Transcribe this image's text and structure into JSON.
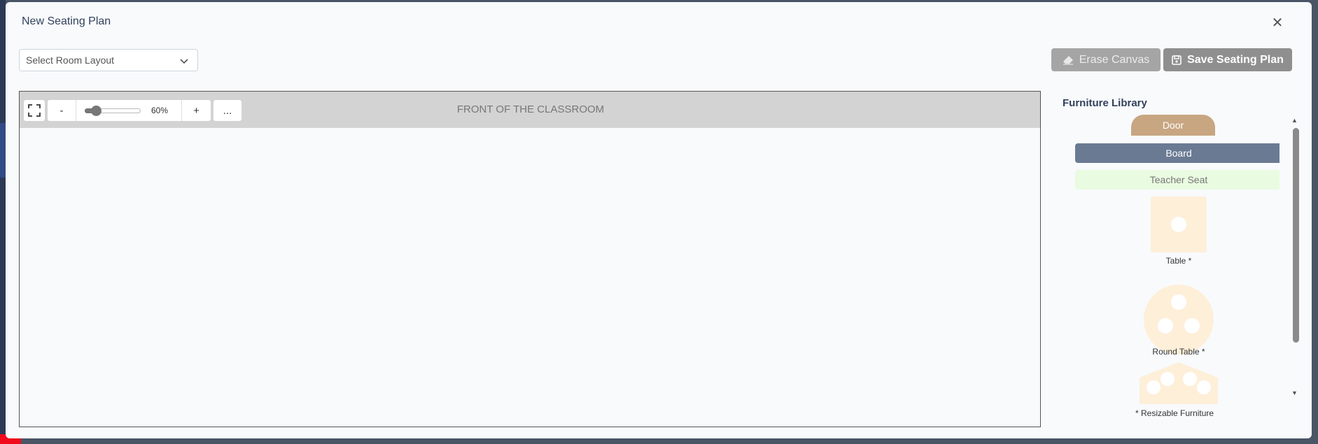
{
  "modal": {
    "title": "New Seating Plan",
    "close_glyph": "✕"
  },
  "room_layout_select": {
    "placeholder": "Select Room Layout"
  },
  "toolbar": {
    "erase_label": "Erase Canvas",
    "save_label": "Save Seating Plan"
  },
  "canvas": {
    "front_label": "FRONT OF THE CLASSROOM",
    "zoom": {
      "minus_label": "-",
      "plus_label": "+",
      "more_label": "...",
      "value_percent": 60,
      "display": "60%"
    }
  },
  "furniture_library": {
    "title": "Furniture Library",
    "items": {
      "door": "Door",
      "board": "Board",
      "teacher_seat": "Teacher Seat",
      "table": "Table *",
      "round_table": "Round Table *"
    },
    "note": "* Resizable Furniture"
  },
  "colors": {
    "door": "#c8a682",
    "board": "#6b7a93",
    "teacher_seat": "#e9fbe0",
    "table": "#feefd9",
    "button_disabled": "#9a9a9a",
    "canvas_header": "#d3d3d3"
  },
  "icons": {
    "close": "close-icon",
    "chevron": "chevron-down-icon",
    "eraser": "eraser-icon",
    "save": "save-icon",
    "fullscreen": "fullscreen-icon"
  }
}
